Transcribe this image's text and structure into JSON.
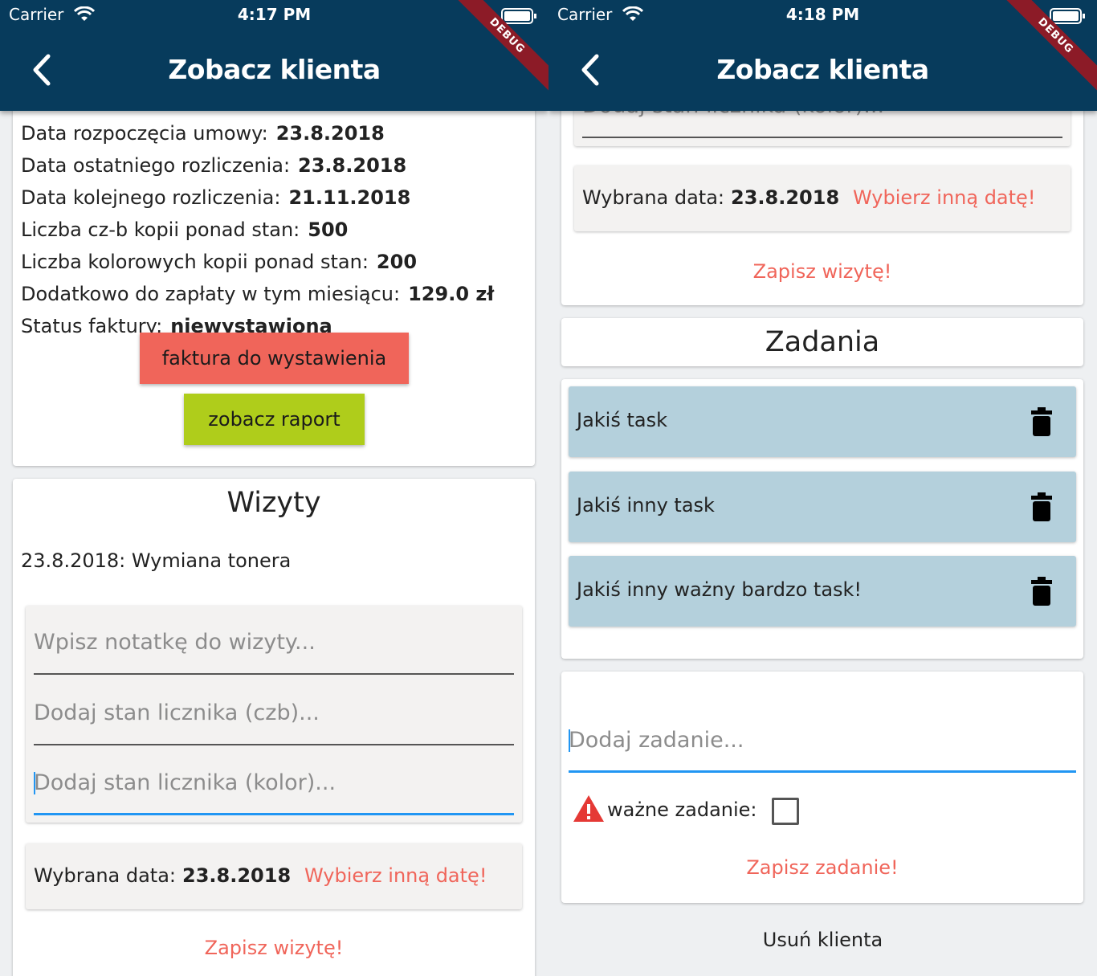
{
  "status_bar": {
    "left": {
      "carrier": "Carrier",
      "time": "4:17 PM"
    },
    "right": {
      "carrier": "Carrier",
      "time": "4:18 PM"
    }
  },
  "app_bar": {
    "title": "Zobacz klienta",
    "debug_banner": "DEBUG"
  },
  "client_info": [
    {
      "label": "Data rozpoczęcia umowy:",
      "value": "23.8.2018"
    },
    {
      "label": "Data ostatniego rozliczenia:",
      "value": "23.8.2018"
    },
    {
      "label": "Data kolejnego rozliczenia:",
      "value": "21.11.2018"
    },
    {
      "label": "Liczba cz-b kopii ponad stan:",
      "value": "500"
    },
    {
      "label": "Liczba kolorowych kopii ponad stan:",
      "value": "200"
    },
    {
      "label": "Dodatkowo do zapłaty w tym miesiącu:",
      "value": "129.0 zł"
    },
    {
      "label": "Status faktury:",
      "value": "niewystawiona"
    }
  ],
  "buttons": {
    "invoice": "faktura do wystawienia",
    "report": "zobacz raport"
  },
  "visits": {
    "title": "Wizyty",
    "entries": [
      "23.8.2018: Wymiana tonera"
    ],
    "note_placeholder": "Wpisz notatkę do wizyty...",
    "counter_bw_placeholder": "Dodaj stan licznika (czb)...",
    "counter_color_placeholder": "Dodaj stan licznika (kolor)...",
    "selected_date_label": "Wybrana data:",
    "selected_date": "23.8.2018",
    "change_date": "Wybierz inną datę!",
    "save": "Zapisz wizytę!"
  },
  "tasks": {
    "title": "Zadania",
    "items": [
      "Jakiś task",
      "Jakiś inny task",
      "Jakiś inny ważny bardzo task!"
    ],
    "new_placeholder": "Dodaj zadanie...",
    "important_label": "ważne zadanie:",
    "important_checked": false,
    "save": "Zapisz zadanie!"
  },
  "delete_client": "Usuń klienta",
  "colors": {
    "app_bar": "#073b5c",
    "accent_red": "#f0655a",
    "report_green": "#afcd1b",
    "task_bg": "#b4d0dc",
    "focus_blue": "#2196f3",
    "warning_red": "#e53935"
  }
}
